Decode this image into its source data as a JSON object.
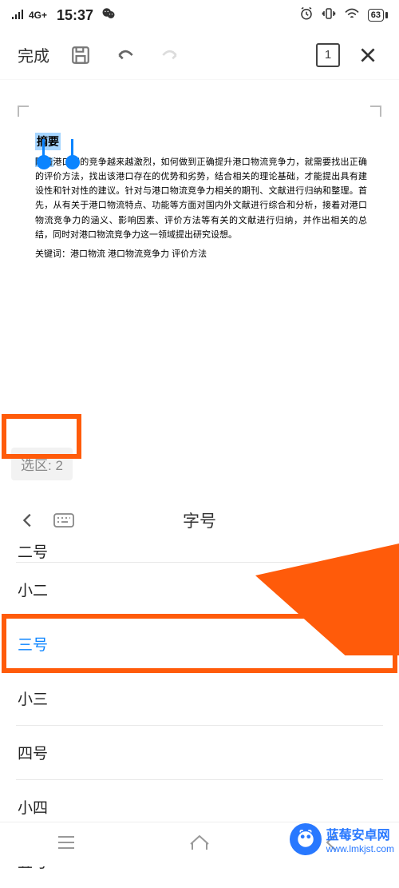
{
  "status_bar": {
    "signal_type": "4G+",
    "time": "15:37",
    "battery_pct": "63"
  },
  "toolbar": {
    "done": "完成",
    "page": "1"
  },
  "doc": {
    "title": "摘要",
    "first_two": "随着",
    "body_rest": "港口间的竞争越来越激烈，如何做到正确提升港口物流竞争力，就需要找出正确的评价方法，找出该港口存在的优势和劣势，结合相关的理论基础，才能提出具有建设性和针对性的建议。针对与港口物流竞争力相关的期刊、文献进行归纳和整理。首先，从有关于港口物流特点、功能等方面对国内外文献进行综合和分析，接着对港口物流竞争力的涵义、影响因素、评价方法等有关的文献进行归纳，并作出相关的总结，同时对港口物流竞争力这一领域提出研究设想。",
    "keywords_label": "关键词：",
    "keywords": "港口物流  港口物流竞争力   评价方法"
  },
  "selection_info": "选区: 2",
  "panel": {
    "title": "字号"
  },
  "sizes": {
    "partial_top": "二号",
    "items": [
      {
        "label": "小二",
        "selected": false
      },
      {
        "label": "三号",
        "selected": true
      },
      {
        "label": "小三",
        "selected": false
      },
      {
        "label": "四号",
        "selected": false
      },
      {
        "label": "小四",
        "selected": false
      },
      {
        "label": "五号",
        "selected": false
      }
    ]
  },
  "watermark": {
    "cn": "蓝莓安卓网",
    "url": "www.lmkjst.com"
  }
}
